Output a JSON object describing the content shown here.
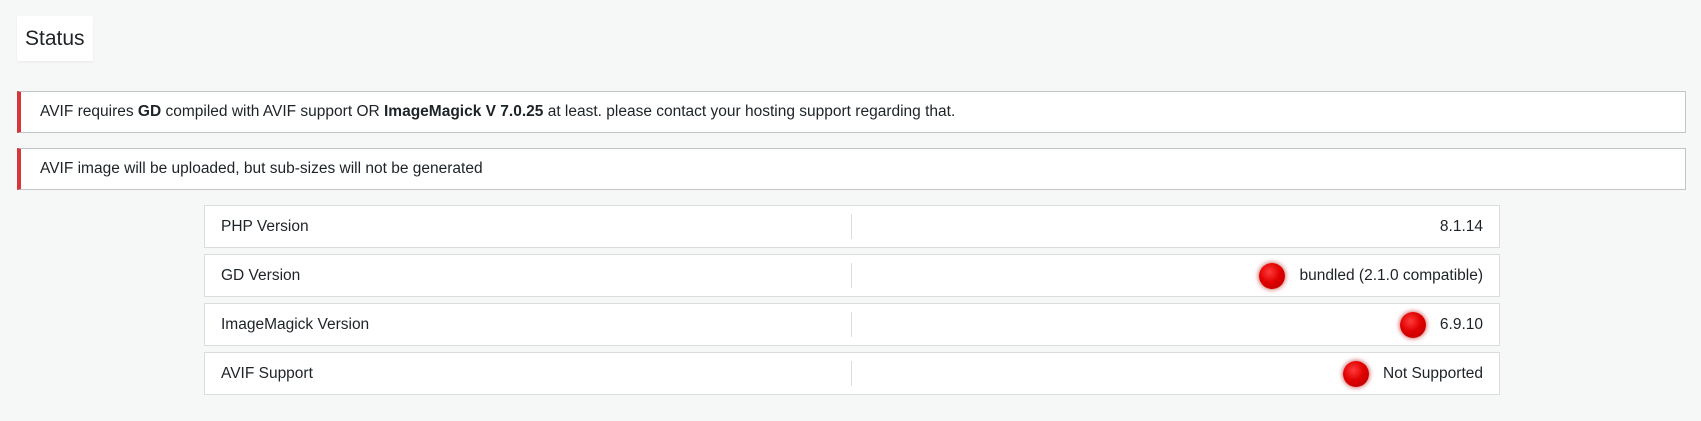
{
  "page": {
    "title": "Status"
  },
  "notices": [
    {
      "segments": [
        {
          "text": "AVIF requires ",
          "bold": false
        },
        {
          "text": "GD",
          "bold": true
        },
        {
          "text": " compiled with AVIF support OR ",
          "bold": false
        },
        {
          "text": "ImageMagick V 7.0.25",
          "bold": true
        },
        {
          "text": " at least. please contact your hosting support regarding that.",
          "bold": false
        }
      ]
    },
    {
      "text": "AVIF image will be uploaded, but sub-sizes will not be generated"
    }
  ],
  "info": [
    {
      "label": "PHP Version",
      "value": "8.1.14",
      "status": null
    },
    {
      "label": "GD Version",
      "value": "bundled (2.1.0 compatible)",
      "status": "error"
    },
    {
      "label": "ImageMagick Version",
      "value": "6.9.10",
      "status": "error"
    },
    {
      "label": "AVIF Support",
      "value": "Not Supported",
      "status": "error"
    }
  ],
  "colors": {
    "notice_error_border": "#d63638",
    "status_error_dot": "#e00000",
    "background": "#f6f7f7"
  },
  "icons": {
    "status_error": "red-status-dot-icon"
  }
}
